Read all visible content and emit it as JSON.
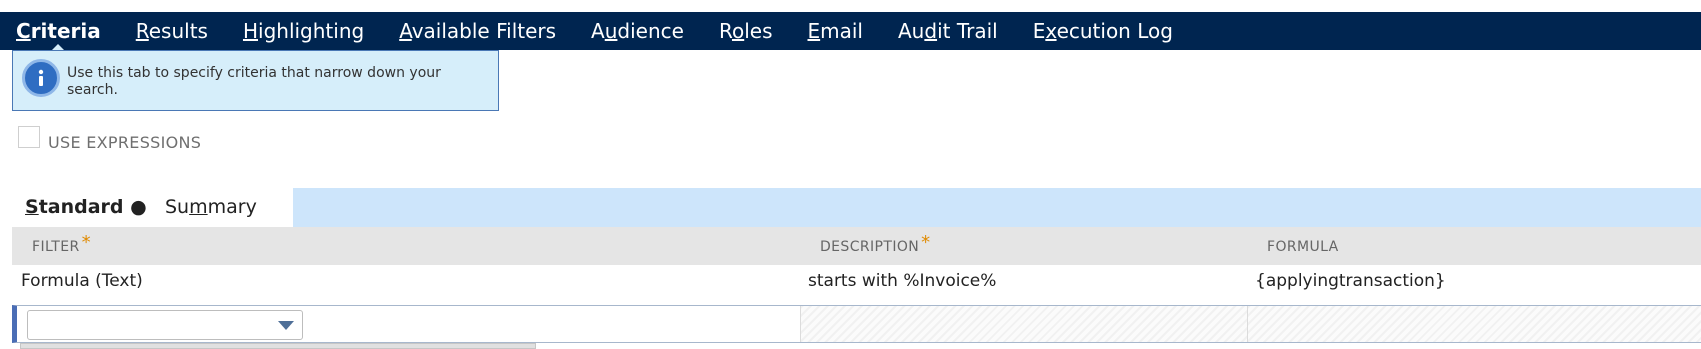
{
  "tabs": [
    {
      "pre": "",
      "u": "C",
      "post": "riteria"
    },
    {
      "pre": "",
      "u": "R",
      "post": "esults"
    },
    {
      "pre": "",
      "u": "H",
      "post": "ighlighting"
    },
    {
      "pre": "",
      "u": "A",
      "post": "vailable Filters"
    },
    {
      "pre": "A",
      "u": "u",
      "post": "dience"
    },
    {
      "pre": "R",
      "u": "o",
      "post": "les"
    },
    {
      "pre": "",
      "u": "E",
      "post": "mail"
    },
    {
      "pre": "Au",
      "u": "d",
      "post": "it Trail"
    },
    {
      "pre": "E",
      "u": "x",
      "post": "ecution Log"
    }
  ],
  "info": {
    "icon": "info-icon",
    "text": "Use this tab to specify criteria that narrow down your search."
  },
  "use_expressions": {
    "label": "USE EXPRESSIONS",
    "checked": false
  },
  "subtabs": {
    "standard": {
      "pre": "",
      "u": "S",
      "post": "tandard",
      "marker": "●"
    },
    "summary": {
      "pre": "Su",
      "u": "m",
      "post": "mary"
    }
  },
  "table": {
    "columns": [
      {
        "label": "FILTER",
        "required": "*"
      },
      {
        "label": "DESCRIPTION",
        "required": "*"
      },
      {
        "label": "FORMULA",
        "required": ""
      }
    ],
    "rows": [
      {
        "filter": "Formula (Text)",
        "description": "starts with %Invoice%",
        "formula": "{applyingtransaction}"
      }
    ],
    "new_row": {
      "filter_value": ""
    }
  },
  "colors": {
    "tabbar": "#002550",
    "info_bg": "#d6eefa",
    "accent": "#4a6db5",
    "required": "#e08a00"
  }
}
